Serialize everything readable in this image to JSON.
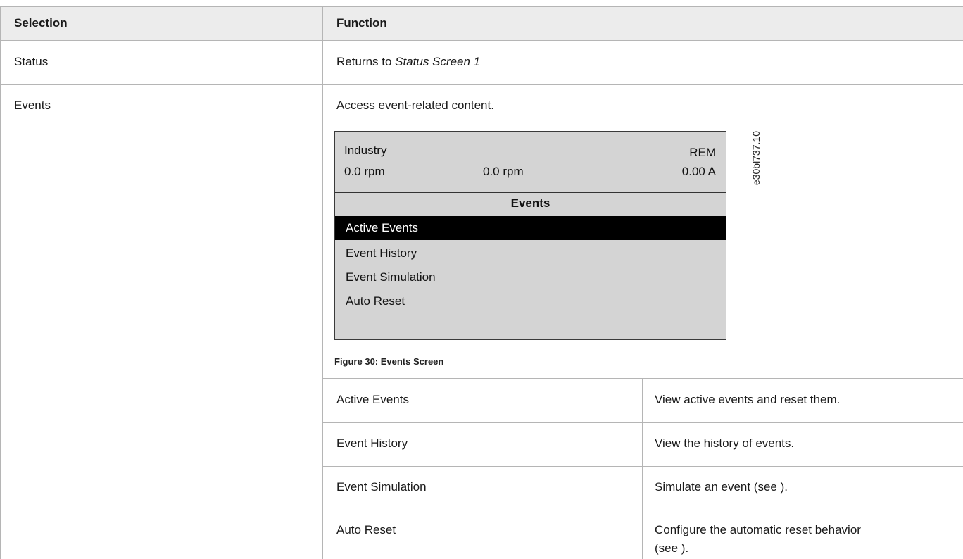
{
  "table": {
    "headers": {
      "selection": "Selection",
      "function": "Function"
    },
    "rows": [
      {
        "selection": "Status",
        "function_prefix": "Returns to ",
        "function_italic": "Status Screen 1"
      },
      {
        "selection": "Events",
        "function": "Access event-related content."
      }
    ]
  },
  "figure": {
    "display": {
      "title_left": "Industry",
      "title_right": "REM",
      "readout_left": "0.0 rpm",
      "readout_center": "0.0 rpm",
      "readout_right": "0.00 A",
      "menu_title": "Events",
      "menu_items": [
        "Active Events",
        "Event History",
        "Event Simulation",
        "Auto Reset"
      ],
      "selected_index": 0
    },
    "id": "e30bl737.10",
    "caption": "Figure 30:  Events Screen"
  },
  "subtable": {
    "rows": [
      {
        "name": "Active Events",
        "desc": "View active events and reset them."
      },
      {
        "name": "Event History",
        "desc": "View the history of events."
      },
      {
        "name": "Event Simulation",
        "desc": "Simulate an event (see )."
      },
      {
        "name": "Auto Reset",
        "desc_line1": "Configure the automatic reset behavior",
        "desc_line2": "(see )."
      }
    ]
  },
  "colors": {
    "header_bg": "#ececec",
    "border": "#b5b5b5",
    "lcd_bg": "#d4d4d4",
    "highlight": "#000000"
  }
}
